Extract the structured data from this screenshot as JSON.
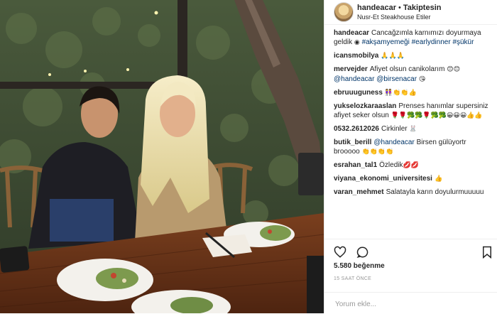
{
  "header": {
    "username": "handeacar",
    "separator": "•",
    "follow_status": "Takiptesin",
    "location": "Nusr-Et Steakhouse Etiler"
  },
  "caption": {
    "username": "handeacar",
    "text": "Cancağzımla karnımızı doyurmaya geldik",
    "emoji": "◉",
    "tags": [
      "#akşamyemeği",
      "#earlydinner",
      "#şükür"
    ]
  },
  "comments": [
    {
      "username": "icansmobilya",
      "text": "",
      "emoji": "🙏🙏🙏"
    },
    {
      "username": "mervejder",
      "text": "Afiyet olsun canikolarım",
      "emoji": "😊😊",
      "mentions": [
        "@handeacar",
        "@birsenacar"
      ],
      "trailing_emoji": "😘"
    },
    {
      "username": "ebruuuguness",
      "text": "",
      "emoji": "👭👏👏👍"
    },
    {
      "username": "yukselozkaraaslan",
      "text": "Prenses hanımlar supersiniz afiyet seker olsun",
      "emoji": "🌹🌹🥦🥦🌹🥦🥦😀😀😀👍👍"
    },
    {
      "username": "0532.2612026",
      "text": "Cirkinler",
      "emoji": "🐰"
    },
    {
      "username": "butik_berill",
      "mention": "@handeacar",
      "text": "Birsen gülüyortr brooooo",
      "emoji": "👏👏👏👏"
    },
    {
      "username": "esrahan_tal1",
      "text": "Özledik",
      "emoji": "💋💋"
    },
    {
      "username": "viyana_ekonomi_universitesi",
      "text": "",
      "emoji": "👍"
    },
    {
      "username": "varan_mehmet",
      "text": "Salatayla karın doyulurmuuuuu",
      "emoji": ""
    }
  ],
  "actions": {
    "like_icon": "heart-icon",
    "comment_icon": "comment-icon",
    "save_icon": "bookmark-icon"
  },
  "likes": "5.580 beğenme",
  "timestamp": "15 SAAT ÖNCE",
  "comment_input": {
    "placeholder": "Yorum ekle...",
    "value": ""
  },
  "colors": {
    "link": "#003569",
    "text": "#262626",
    "muted": "#999999",
    "border": "#efefef"
  }
}
